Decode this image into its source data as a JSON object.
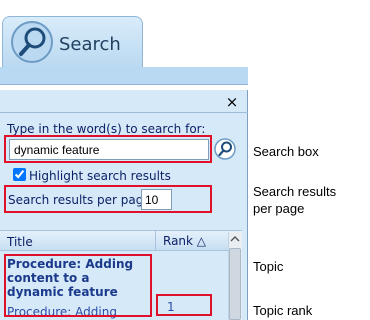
{
  "tab": {
    "label": "Search",
    "icon": "magnifier-icon"
  },
  "pane": {
    "close_glyph": "×",
    "prompt": "Type in the word(s) to search for:",
    "search_value": "dynamic feature",
    "highlight_label": "Highlight search results",
    "highlight_checked": true,
    "results_per_page_label": "Search results per page",
    "results_per_page_value": "10"
  },
  "results": {
    "columns": {
      "title": "Title",
      "rank": "Rank △"
    },
    "rows": [
      {
        "title": "Procedure: Adding content to a dynamic feature",
        "subtitle": "Procedure: Adding",
        "rank": "1"
      }
    ]
  },
  "annotations": {
    "search_box": "Search box",
    "results_per_page_line1": "Search results",
    "results_per_page_line2": "per page",
    "topic": "Topic",
    "topic_rank": "Topic rank"
  },
  "colors": {
    "accent_blue": "#d6e9f8",
    "callout_red": "#e0102a",
    "text_navy": "#0b1f66"
  }
}
